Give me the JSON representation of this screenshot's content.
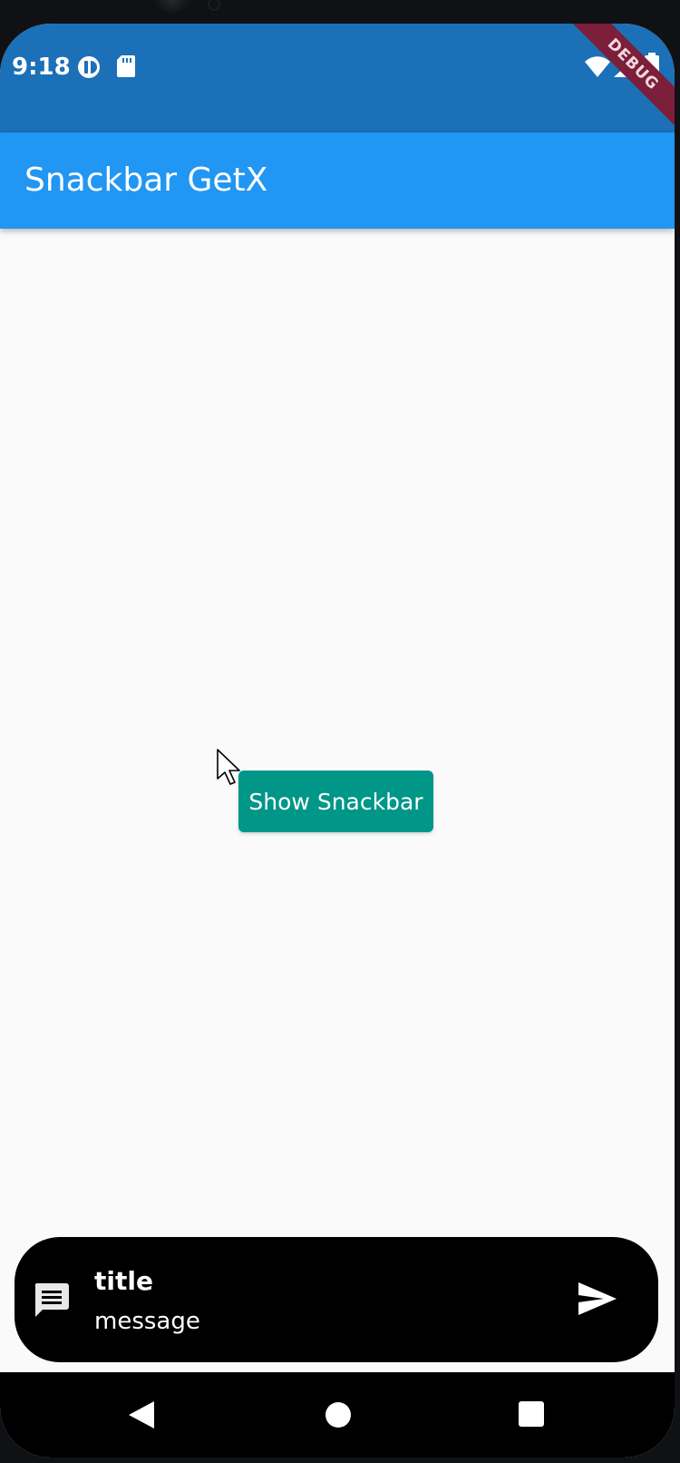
{
  "status_bar": {
    "time": "9:18",
    "icons": [
      "data-saver-icon",
      "sd-card-icon",
      "wifi-icon",
      "signal-icon",
      "battery-icon"
    ],
    "color": "#1b70b8"
  },
  "debug_banner": {
    "label": "DEBUG",
    "color": "#7b1f3a"
  },
  "app_bar": {
    "title": "Snackbar GetX",
    "color": "#2196f3"
  },
  "main": {
    "show_button": {
      "label": "Show Snackbar",
      "color": "#009688"
    }
  },
  "snackbar": {
    "icon": "message-icon",
    "title": "title",
    "message": "message",
    "action_icon": "send-icon",
    "background": "#000000"
  },
  "nav_bar": {
    "buttons": [
      "back-icon",
      "home-icon",
      "recents-icon"
    ]
  }
}
